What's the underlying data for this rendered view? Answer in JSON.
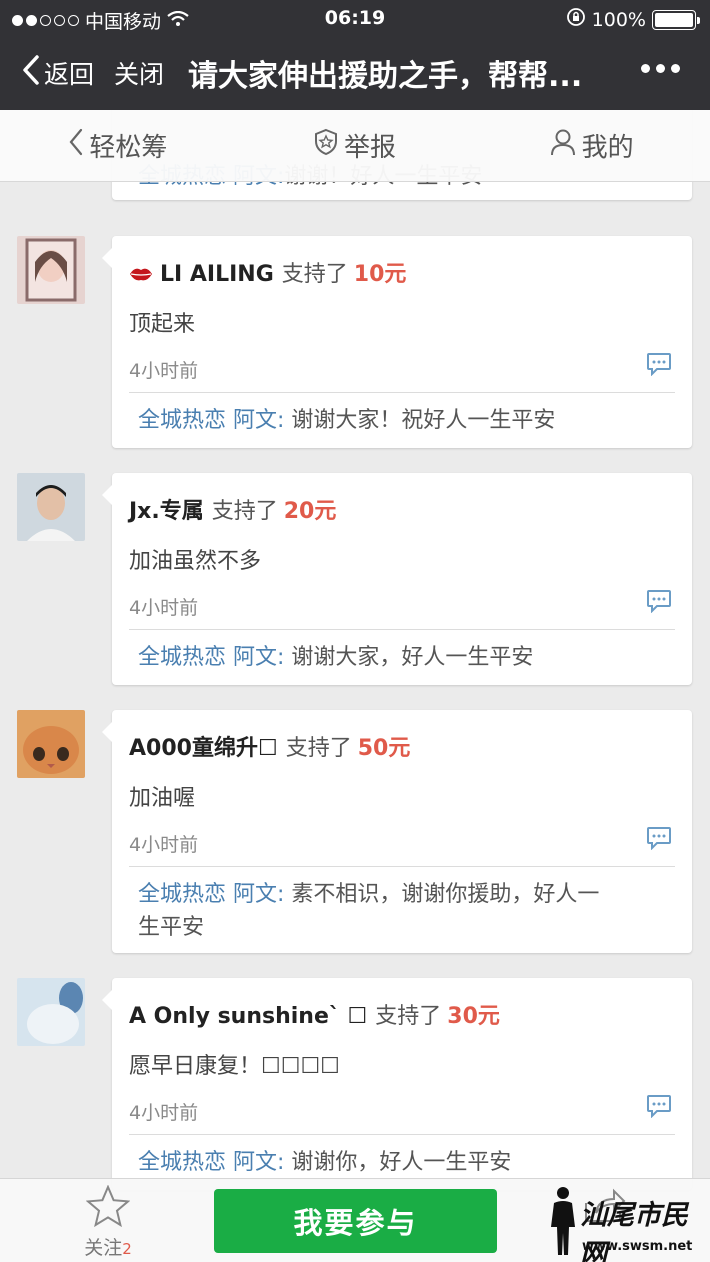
{
  "status_bar": {
    "carrier": "中国移动",
    "time": "06:19",
    "battery_percent": "100%",
    "battery_level": 1.0
  },
  "nav": {
    "back_label": "返回",
    "close_label": "关闭",
    "title": "请大家伸出援助之手，帮帮..."
  },
  "tabs": [
    {
      "label": "轻松筹",
      "icon": "chevron-left-icon"
    },
    {
      "label": "举报",
      "icon": "shield-star-icon"
    },
    {
      "label": "我的",
      "icon": "user-icon"
    }
  ],
  "partial_top_reply": {
    "who": "全城热恋 阿文:",
    "text": "谢谢！好人一生平安"
  },
  "posts": [
    {
      "name": "LI AILING",
      "has_lips_emoji": true,
      "verb": "支持了",
      "amount": "10元",
      "message": "顶起来",
      "time": "4小时前",
      "reply_who": "全城热恋 阿文:",
      "reply_text": "谢谢大家！祝好人一生平安",
      "avatar_color": "#e9c9c6"
    },
    {
      "name": "Jx.专属",
      "has_lips_emoji": false,
      "verb": "支持了",
      "amount": "20元",
      "message": "加油虽然不多",
      "time": "4小时前",
      "reply_who": "全城热恋 阿文:",
      "reply_text": "谢谢大家，好人一生平安",
      "avatar_color": "#b9c4cf"
    },
    {
      "name": "A000童绵升☐",
      "has_lips_emoji": false,
      "verb": "支持了",
      "amount": "50元",
      "message": "加油喔",
      "time": "4小时前",
      "reply_who": "全城热恋 阿文:",
      "reply_text": "素不相识，谢谢你援助，好人一生平安",
      "avatar_color": "#d9914c"
    },
    {
      "name": "A Only sunshine` ☐",
      "has_lips_emoji": false,
      "verb": "支持了",
      "amount": "30元",
      "message": "愿早日康复！☐☐☐☐",
      "time": "4小时前",
      "reply_who": "全城热恋 阿文:",
      "reply_text": "谢谢你，好人一生平安",
      "avatar_color": "#c8dbe8"
    }
  ],
  "bottom_bar": {
    "follow_label": "关注",
    "follow_count": "2",
    "join_label": "我要参与"
  },
  "watermark": {
    "line1": "汕尾市民网",
    "line2": "www.swsm.net"
  },
  "colors": {
    "header_bg": "#323236",
    "amount": "#e05a4a",
    "reply_name": "#4a7fb0",
    "join_button": "#1aad45",
    "page_bg": "#ebebeb"
  }
}
